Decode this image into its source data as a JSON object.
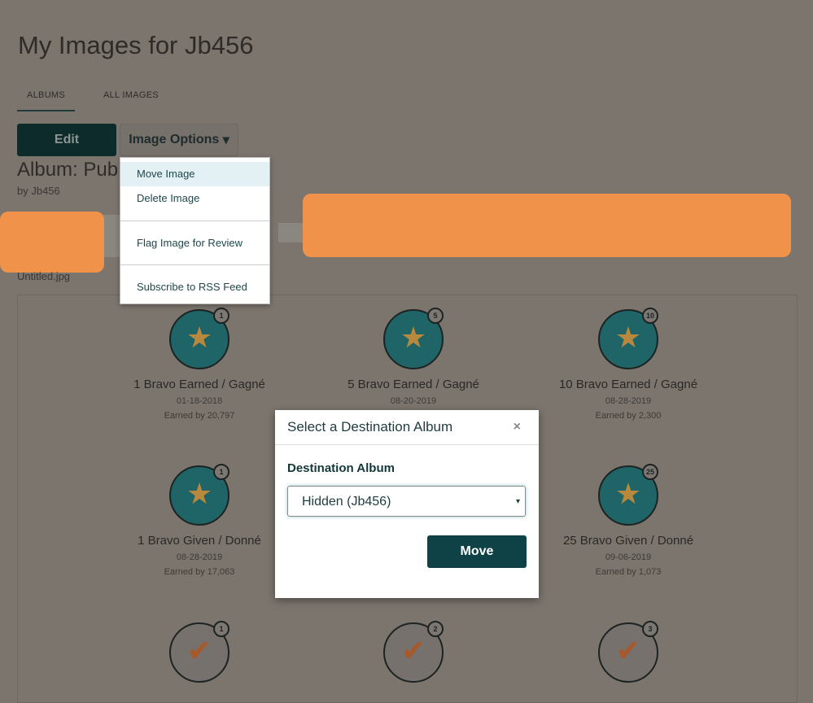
{
  "page_title": "My Images for Jb456",
  "tabs": [
    {
      "label": "ALBUMS",
      "active": true
    },
    {
      "label": "ALL IMAGES",
      "active": false
    }
  ],
  "toolbar": {
    "edit_label": "Edit",
    "options_label": "Image Options",
    "options_caret": "▾"
  },
  "album": {
    "title": "Album: Pub",
    "by": "by Jb456",
    "filename": "Untitled.jpg"
  },
  "menu": {
    "items": [
      {
        "label": "Move Image",
        "highlighted": true
      },
      {
        "label": "Delete Image"
      },
      {
        "label": "Flag Image for Review"
      },
      {
        "label": "Subscribe to RSS Feed"
      }
    ]
  },
  "badges": [
    {
      "count": "1",
      "name": "1 Bravo Earned / Gagné",
      "date": "01-18-2018",
      "earned": "Earned by 20,797",
      "icon": "star-ribbon-icon"
    },
    {
      "count": "5",
      "name": "5 Bravo Earned / Gagné",
      "date": "08-20-2019",
      "earned": "",
      "icon": "star-ribbon-icon"
    },
    {
      "count": "10",
      "name": "10 Bravo Earned / Gagné",
      "date": "08-28-2019",
      "earned": "Earned by 2,300",
      "icon": "star-ribbon-icon"
    },
    {
      "count": "1",
      "name": "1 Bravo Given / Donné",
      "date": "08-28-2019",
      "earned": "Earned by 17,063",
      "icon": "star-chevron-icon"
    },
    {
      "count": "25",
      "name": "25 Bravo Given / Donné",
      "date": "09-06-2019",
      "earned": "Earned by 1,073",
      "icon": "star-chevron-icon"
    },
    {
      "count": "1",
      "icon": "checkmark-icon"
    },
    {
      "count": "2",
      "icon": "checkmark-icon"
    },
    {
      "count": "3",
      "icon": "checkmark-icon"
    }
  ],
  "modal": {
    "title": "Select a Destination Album",
    "close": "×",
    "field_label": "Destination Album",
    "selected": "Hidden (Jb456)",
    "caret": "▾",
    "move_label": "Move"
  },
  "colors": {
    "primary": "#0e4247",
    "overlay": "#7c756e",
    "redaction": "#f0924a",
    "menu_highlight": "#e3f1f5"
  }
}
